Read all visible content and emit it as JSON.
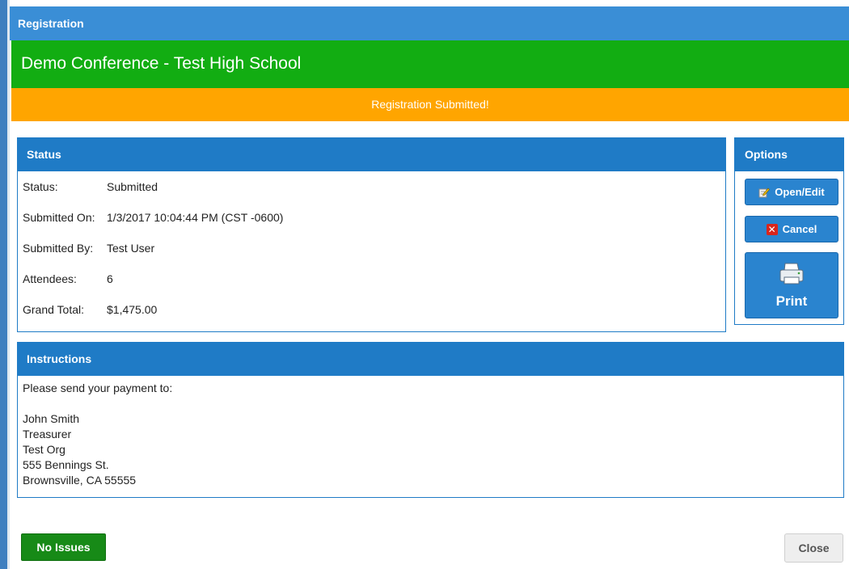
{
  "dialog": {
    "title": "Registration",
    "event_title": "Demo Conference - Test High School",
    "banner": "Registration Submitted!"
  },
  "status_panel": {
    "header": "Status",
    "rows": [
      {
        "label": "Status:",
        "value": "Submitted"
      },
      {
        "label": "Submitted On:",
        "value": "1/3/2017 10:04:44 PM (CST -0600)"
      },
      {
        "label": "Submitted By:",
        "value": "Test User"
      },
      {
        "label": "Attendees:",
        "value": "6"
      },
      {
        "label": "Grand Total:",
        "value": "$1,475.00"
      }
    ]
  },
  "options_panel": {
    "header": "Options",
    "open_edit_label": "Open/Edit",
    "cancel_label": "Cancel",
    "print_label": "Print"
  },
  "instructions_panel": {
    "header": "Instructions",
    "body": "Please send your payment to:\n\nJohn Smith\nTreasurer\nTest Org\n555 Bennings St.\nBrownsville, CA 55555"
  },
  "footer": {
    "no_issues_label": "No Issues",
    "close_label": "Close"
  },
  "colors": {
    "titlebar": "#3a8ed6",
    "event_banner": "#12ad12",
    "submitted_banner": "#ffa500",
    "panel_accent": "#1f7bc6",
    "no_issues": "#178a17"
  },
  "icons": {
    "open_edit": "edit-pencil-icon",
    "cancel": "red-x-icon",
    "print": "printer-icon"
  }
}
